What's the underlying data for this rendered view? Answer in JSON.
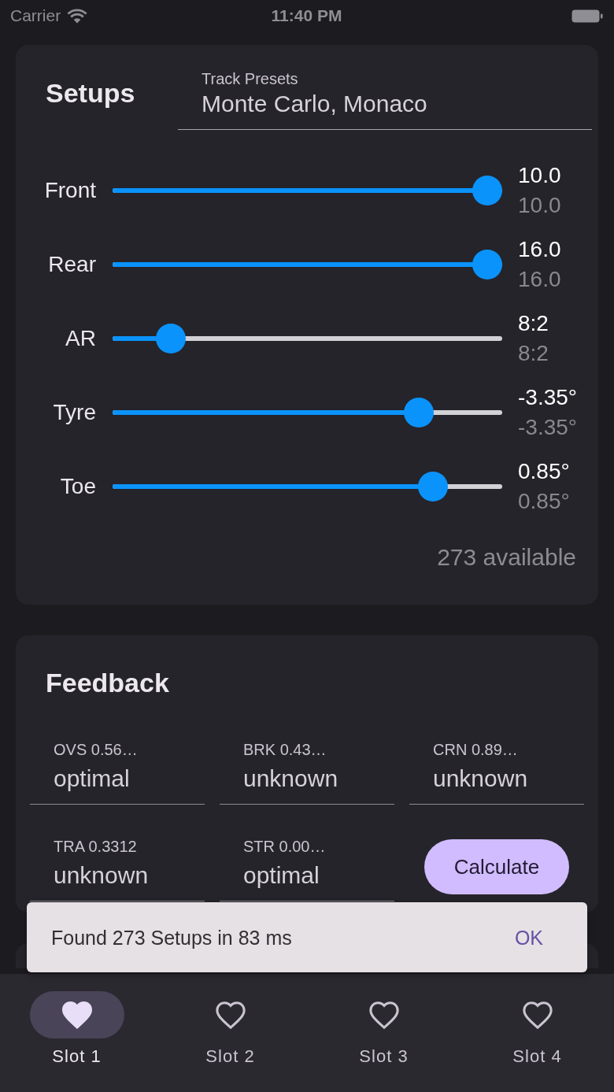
{
  "status_bar": {
    "carrier": "Carrier",
    "time": "11:40 PM"
  },
  "setups": {
    "title": "Setups",
    "track_presets": {
      "label": "Track Presets",
      "value": "Monte Carlo, Monaco"
    },
    "sliders": [
      {
        "label": "Front",
        "level": 1.0,
        "value": "10.0",
        "reference_value": "10.0"
      },
      {
        "label": "Rear",
        "level": 1.0,
        "value": "16.0",
        "reference_value": "16.0"
      },
      {
        "label": "AR",
        "level": 0.12,
        "value": "8:2",
        "reference_value": "8:2"
      },
      {
        "label": "Tyre",
        "level": 0.81,
        "value": "-3.35°",
        "reference_value": "-3.35°"
      },
      {
        "label": "Toe",
        "level": 0.85,
        "value": "0.85°",
        "reference_value": "0.85°"
      }
    ],
    "available": "273 available"
  },
  "feedback": {
    "title": "Feedback",
    "fields": [
      {
        "label": "OVS 0.56…",
        "value": "optimal"
      },
      {
        "label": "BRK 0.43…",
        "value": "unknown"
      },
      {
        "label": "CRN 0.89…",
        "value": "unknown"
      },
      {
        "label": "TRA 0.3312",
        "value": "unknown"
      },
      {
        "label": "STR 0.00…",
        "value": "optimal"
      }
    ],
    "calculate_button": "Calculate"
  },
  "snackbar": {
    "message": "Found 273 Setups in 83 ms",
    "action": "OK"
  },
  "bottom_nav": [
    {
      "label": "Slot 1",
      "selected": true
    },
    {
      "label": "Slot 2",
      "selected": false
    },
    {
      "label": "Slot 3",
      "selected": false
    },
    {
      "label": "Slot 4",
      "selected": false
    }
  ]
}
